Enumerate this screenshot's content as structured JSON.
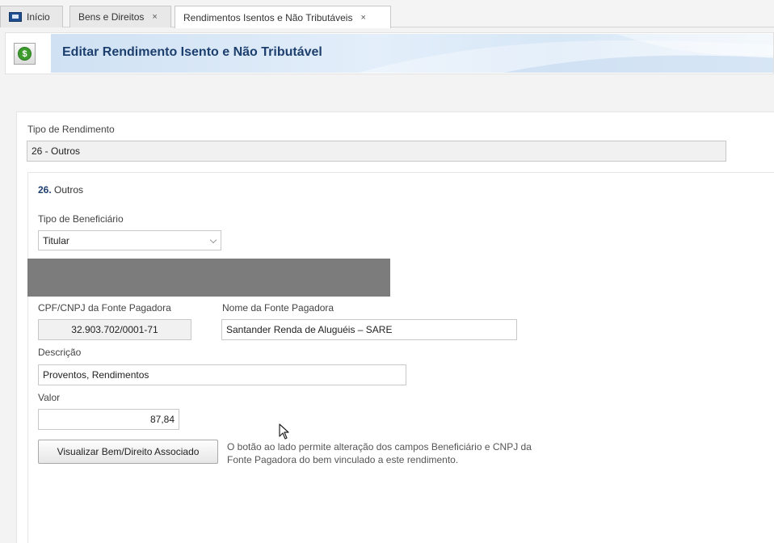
{
  "tabs": [
    {
      "label": "Início",
      "icon": "home-icon",
      "closable": false
    },
    {
      "label": "Bens e Direitos",
      "closable": true,
      "close_glyph": "×"
    },
    {
      "label": "Rendimentos Isentos e Não Tributáveis",
      "closable": true,
      "close_glyph": "×",
      "active": true
    }
  ],
  "header": {
    "title": "Editar Rendimento Isento e Não Tributável",
    "icon": "coin-icon",
    "icon_glyph": "$"
  },
  "form": {
    "tipo_rendimento": {
      "label": "Tipo de Rendimento",
      "value": "26 - Outros"
    },
    "section": {
      "number": "26.",
      "name": "Outros"
    },
    "tipo_beneficiario": {
      "label": "Tipo de Beneficiário",
      "value": "Titular"
    },
    "cpf_cnpj": {
      "label": "CPF/CNPJ da Fonte Pagadora",
      "value": "32.903.702/0001-71"
    },
    "nome_fonte": {
      "label": "Nome da Fonte Pagadora",
      "value": "Santander Renda de Aluguéis – SARE"
    },
    "descricao": {
      "label": "Descrição",
      "value": "Proventos, Rendimentos"
    },
    "valor": {
      "label": "Valor",
      "value": "87,84"
    },
    "button_label": "Visualizar Bem/Direito Associado",
    "hint_line1": "O botão ao lado permite alteração dos campos Beneficiário e CNPJ da",
    "hint_line2": "Fonte Pagadora do bem vinculado a este rendimento."
  },
  "colors": {
    "title": "#1d3f6e",
    "redaction": "#7c7c7c",
    "banner": "#cfe1f3"
  }
}
